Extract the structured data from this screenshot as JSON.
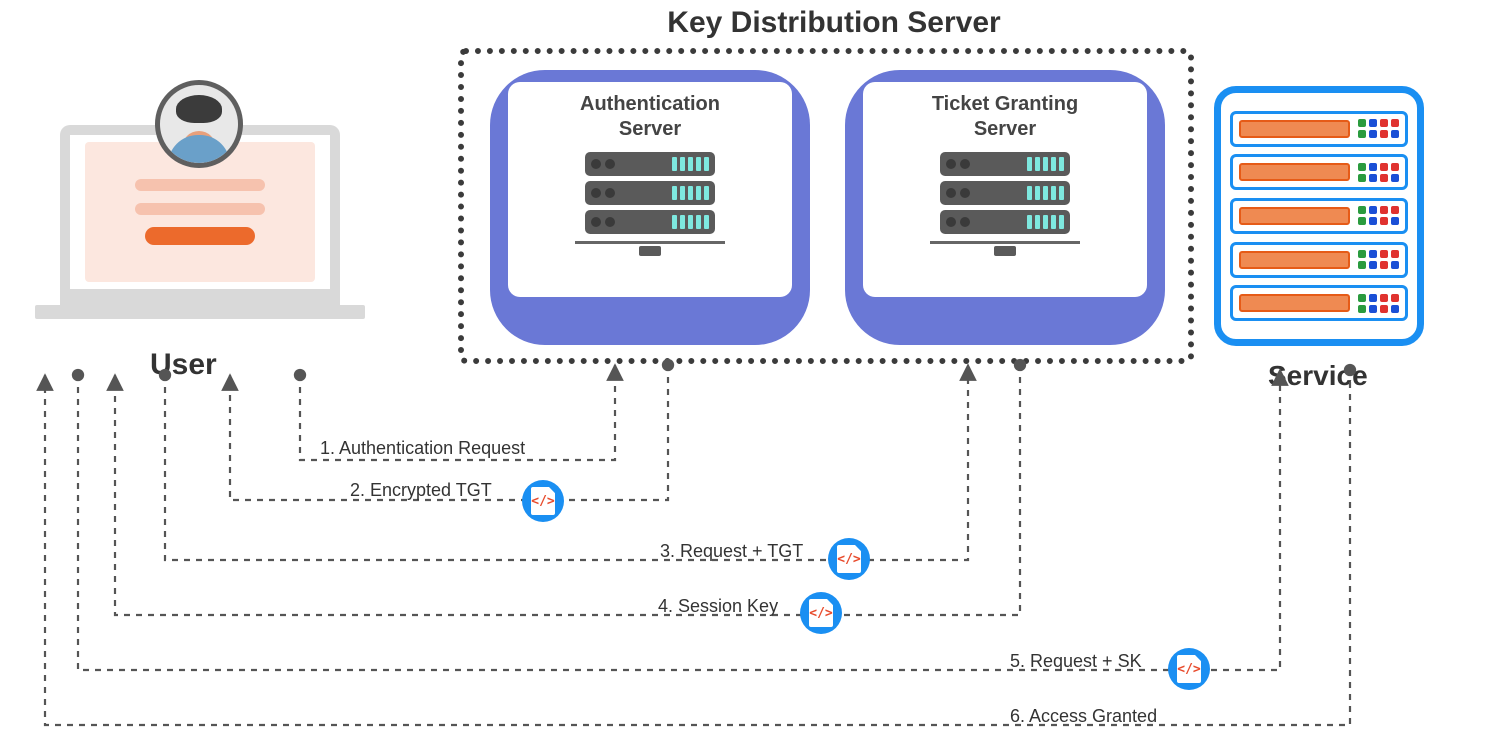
{
  "title": "Key Distribution Server",
  "auth_server": {
    "title": "Authentication\nServer"
  },
  "tgs_server": {
    "title": "Ticket Granting\nServer"
  },
  "user_label": "User",
  "service_label": "Service",
  "flows": {
    "f1": "1. Authentication Request",
    "f2": "2. Encrypted TGT",
    "f3": "3. Request + TGT",
    "f4": "4. Session Key",
    "f5": "5. Request + SK",
    "f6": "6. Access Granted"
  },
  "ticket_glyph": "</>",
  "led_colors": [
    "#2a9b3e",
    "#1a4fd6",
    "#e0322f",
    "#e0322f",
    "#2a9b3e",
    "#1a4fd6",
    "#e0322f",
    "#1a4fd6"
  ]
}
